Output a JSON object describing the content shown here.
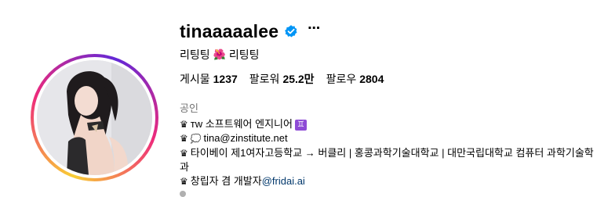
{
  "profile": {
    "username": "tinaaaaalee",
    "more_icon": "⋯",
    "subname_left": "리팅팅",
    "subname_icon": "🌺",
    "subname_right": "리팅팅"
  },
  "stats": {
    "posts_label": "게시물",
    "posts_value": "1237",
    "followers_label": "팔로워",
    "followers_value": "25.2만",
    "following_label": "팔로우",
    "following_value": "2804"
  },
  "category": "공인",
  "bio": {
    "crown": "♛",
    "line1_text": "ᴛᴡ 소프트웨어 엔지니어",
    "line1_badge": "♊",
    "line2_icon": "💭",
    "line2_text": "tina@zinstitute.net",
    "line3_text": "타이베이 제1여자고등학교 → 버클리 | 홍콩과학기술대학교 | 대만국립대학교 컴퓨터 과학기술학과",
    "line4_text": "창립자 겸 개발자",
    "line4_link": "@fridai.ai"
  },
  "colors": {
    "verified": "#0095f6",
    "link": "#00376b",
    "muted": "#737373"
  }
}
